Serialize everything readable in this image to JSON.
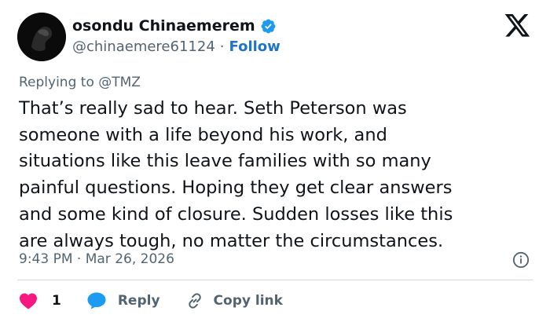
{
  "user": {
    "display_name": "osondu Chinaemerem",
    "handle": "@chinaemere61124",
    "separator": "·",
    "follow_label": "Follow",
    "verified": true
  },
  "tweet": {
    "replying_to": "Replying to @TMZ",
    "lines": [
      "That’s really sad to hear. Seth Peterson was",
      "someone with a life beyond his work, and",
      "situations like this leave families with so many",
      "painful questions. Hoping they get clear answers",
      "and some kind of closure. Sudden losses like this",
      "are always tough, no matter the circumstances."
    ],
    "timestamp": "9:43 PM · Mar 26, 2026"
  },
  "actions": {
    "like_count": "1",
    "reply_label": "Reply",
    "copy_label": "Copy link"
  },
  "colors": {
    "like": "#f91880",
    "reply": "#1d9bf0",
    "follow": "#1d74c8",
    "verified": "#1d9bf0"
  },
  "icons": [
    "verified-badge-icon",
    "x-logo-icon",
    "info-icon",
    "heart-icon",
    "reply-bubble-icon",
    "link-icon"
  ]
}
